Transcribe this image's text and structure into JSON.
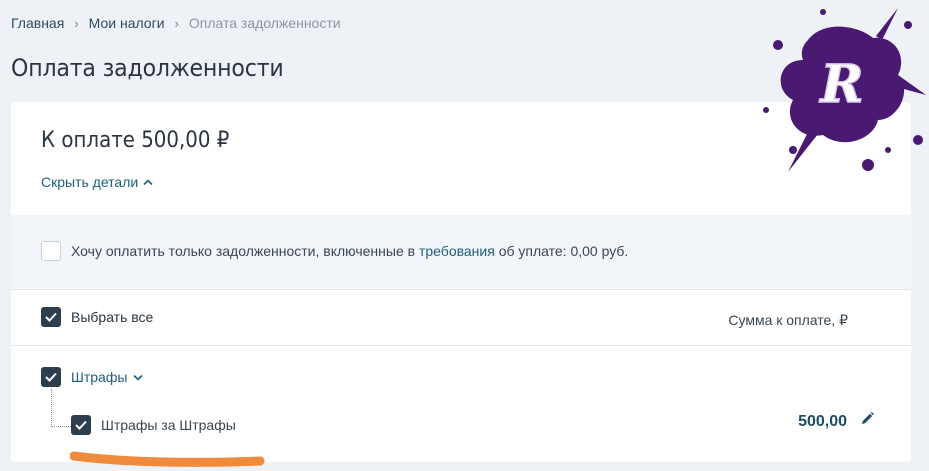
{
  "breadcrumb": {
    "items": [
      "Главная",
      "Мои налоги"
    ],
    "current": "Оплата задолженности",
    "separator": "›"
  },
  "page_title": "Оплата задолженности",
  "summary": {
    "amount_label": "К оплате 500,00 ₽",
    "toggle_details": "Скрыть детали"
  },
  "requirement_filter": {
    "checked": false,
    "text_before": "Хочу оплатить только задолженности, включенные в ",
    "link": "требования",
    "text_after": " об уплате: 0,00 руб."
  },
  "table": {
    "select_all_label": "Выбрать все",
    "select_all_checked": true,
    "amount_column": "Сумма к оплате, ₽",
    "groups": [
      {
        "label": "Штрафы",
        "checked": true,
        "items": [
          {
            "label": "Штрафы за Штрафы",
            "checked": true,
            "amount": "500,00"
          }
        ]
      }
    ]
  },
  "colors": {
    "accent": "#1d5f7a",
    "checkbox": "#2d3e4f",
    "highlight_stroke": "#f08a3c",
    "watermark": "#4a1a72"
  },
  "icons": {
    "chevron": "chevron-up-icon",
    "check": "check-icon",
    "edit": "pencil-icon",
    "watermark": "splash-logo-r"
  },
  "watermark_letter": "R"
}
